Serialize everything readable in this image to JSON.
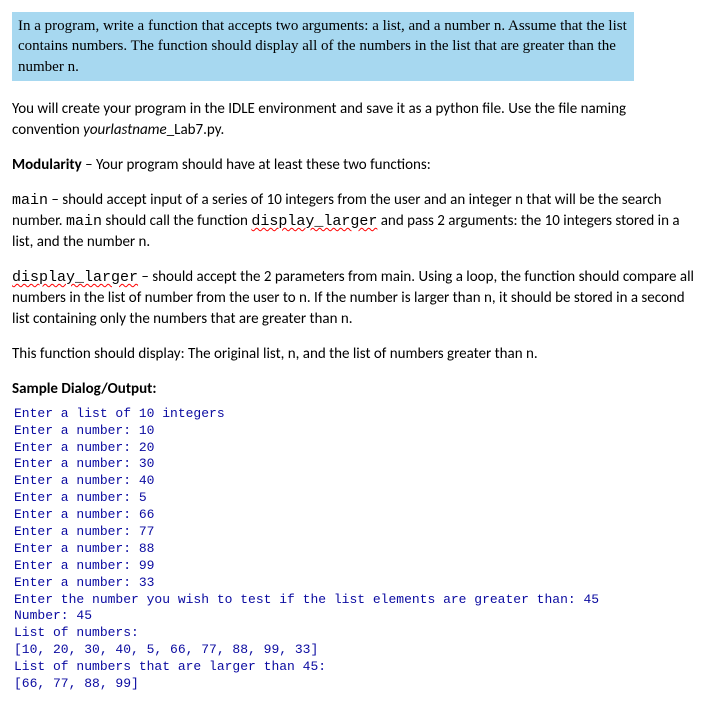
{
  "problem_statement": "In a program, write a function that accepts two arguments: a list, and a number n. Assume that the list contains numbers. The function should display all of the numbers in the list that are greater than the number n.",
  "intro_part1": "You will create your program in the IDLE environment and save it as a python file.  Use the file naming convention ",
  "intro_filename_italic": "yourlastname",
  "intro_filename_rest": "_Lab7.py.",
  "modularity_label": "Modularity",
  "modularity_rest": " – Your program should have at least these two functions:",
  "main_code": "main",
  "main_desc1": " – should accept input of a series of 10 integers from the user and an integer n that will be the search number. ",
  "main_code2": "main",
  "main_desc2": "  should call the function ",
  "display_larger_code": "display_larger",
  "main_desc3": "  and pass 2 arguments:   the 10 integers stored in a list, and the number n.",
  "display_larger_code2": "display_larger",
  "display_larger_desc": "  – should accept the 2 parameters from main.   Using a loop, the function should compare all numbers in the list of number from the user to n.   If the number is larger than n, it should be stored in a second list containing only the numbers that are greater than n.",
  "function_display": "This function should display:   The original list, n, and the list of numbers greater than n.",
  "sample_heading": "Sample Dialog/Output:",
  "sample_output": "Enter a list of 10 integers\nEnter a number: 10\nEnter a number: 20\nEnter a number: 30\nEnter a number: 40\nEnter a number: 5\nEnter a number: 66\nEnter a number: 77\nEnter a number: 88\nEnter a number: 99\nEnter a number: 33\nEnter the number you wish to test if the list elements are greater than: 45\nNumber: 45\nList of numbers:\n[10, 20, 30, 40, 5, 66, 77, 88, 99, 33]\nList of numbers that are larger than 45:\n[66, 77, 88, 99]"
}
